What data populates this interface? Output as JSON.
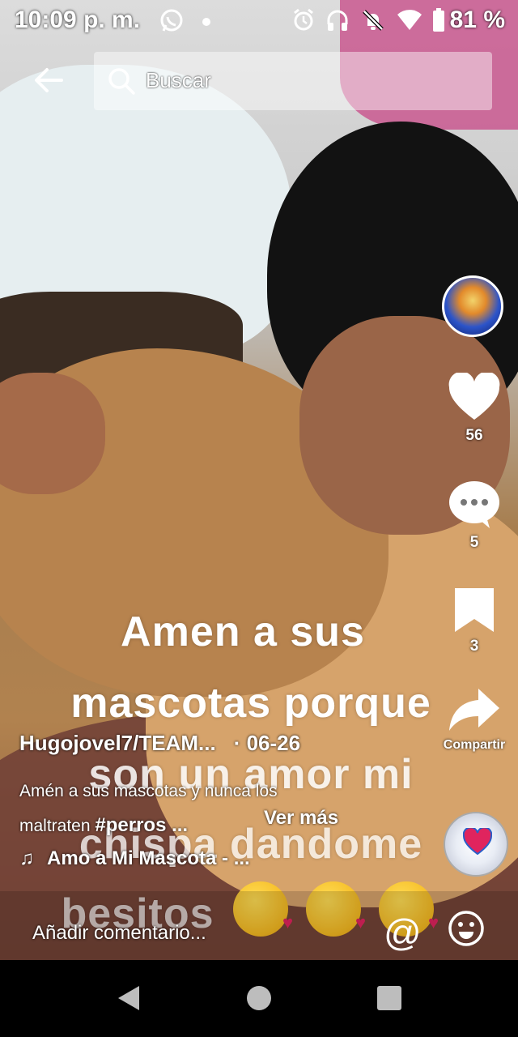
{
  "status_bar": {
    "time": "10:09 p. m.",
    "battery": "81 %",
    "icons": [
      "whatsapp-icon",
      "dot-icon",
      "alarm-icon",
      "headset-icon",
      "bell-off-icon",
      "wifi-icon",
      "battery-icon"
    ]
  },
  "search": {
    "placeholder": "Buscar"
  },
  "video_overlay": {
    "lines": [
      "Amen a sus",
      "mascotas porque",
      "son un amor mi",
      "chispa dandome",
      "besitos"
    ],
    "emoji": [
      "kissing-face-emoji",
      "kissing-face-emoji",
      "kissing-face-emoji"
    ]
  },
  "actions": {
    "likes": "56",
    "comments": "5",
    "saves": "3",
    "share_label": "Compartir"
  },
  "post": {
    "author": "Hugojovel7/TEAM...",
    "date": "· 06-26",
    "caption_line1": "Amén a sus mascotas y nunca los",
    "caption_line2": "maltraten ",
    "hashtag": "#perros ...",
    "see_more": "Ver más",
    "music": "Amo a Mi Mascota - ..."
  },
  "comment_bar": {
    "placeholder": "Añadir comentario..."
  },
  "colors": {
    "accent_like": "#ffffff",
    "nav_icons": "#bdbdbd"
  }
}
